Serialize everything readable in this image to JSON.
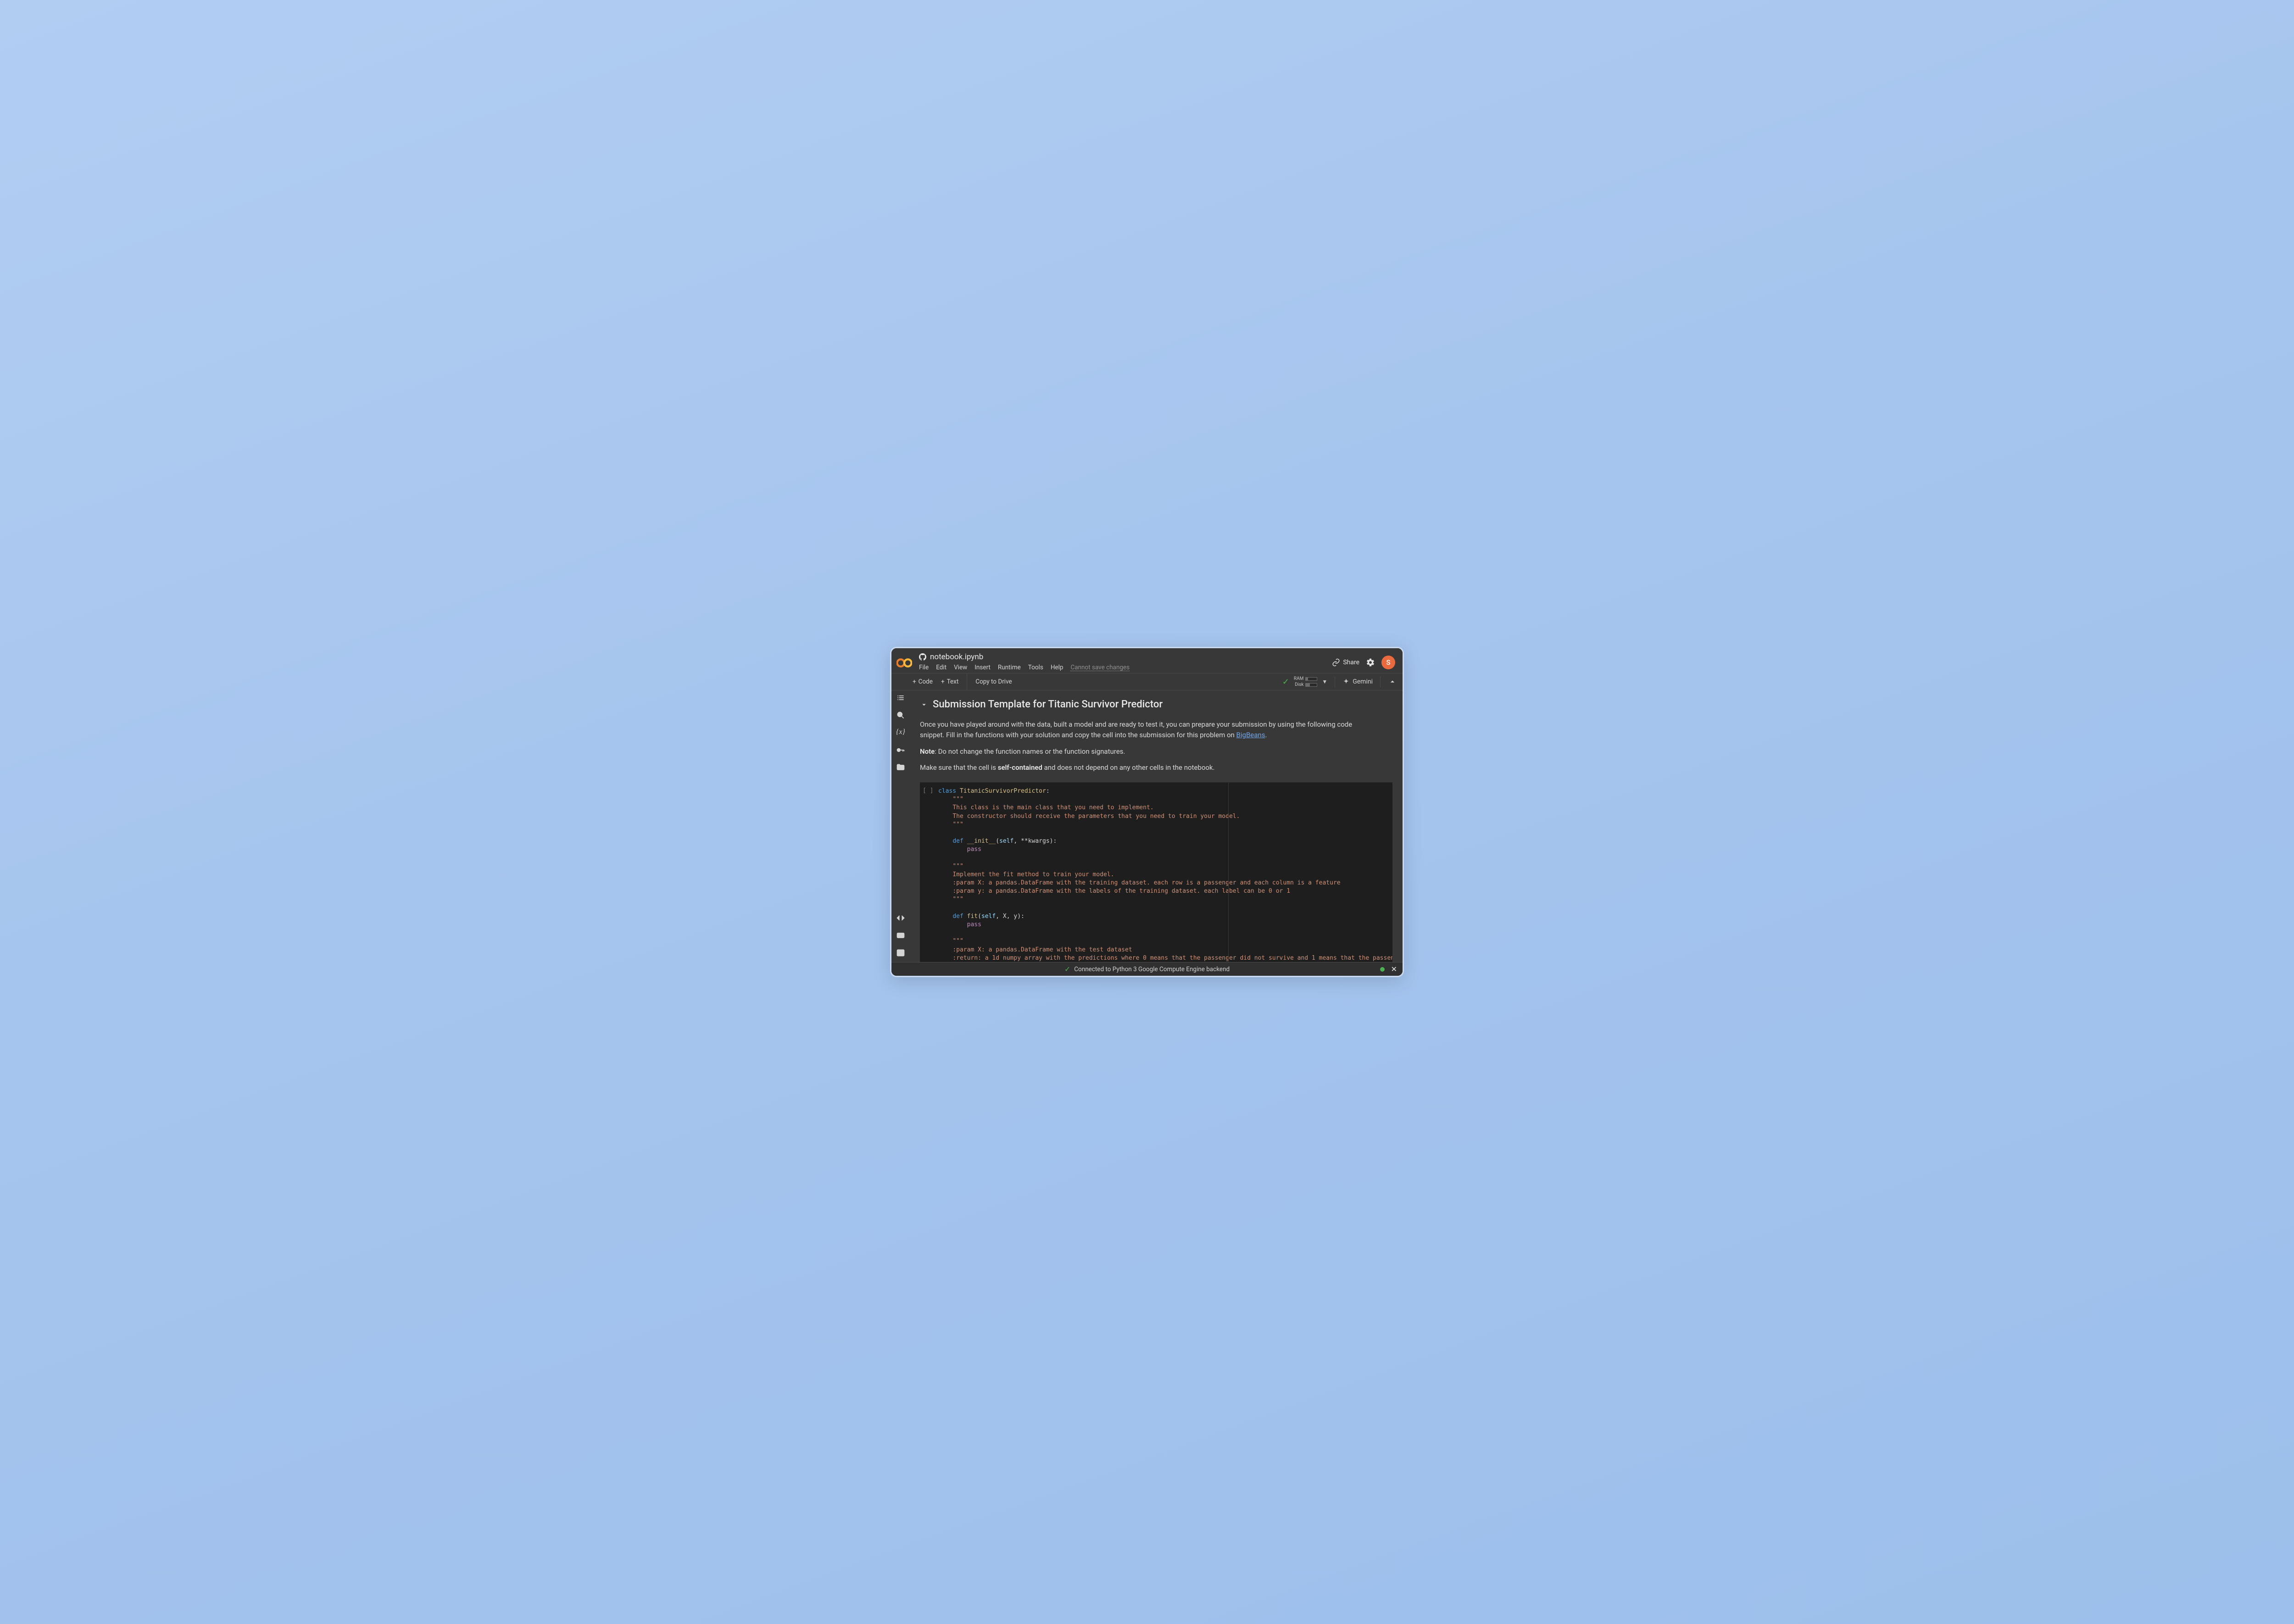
{
  "header": {
    "filename": "notebook.ipynb",
    "menus": [
      "File",
      "Edit",
      "View",
      "Insert",
      "Runtime",
      "Tools",
      "Help"
    ],
    "disabled_note": "Cannot save changes",
    "share_label": "Share",
    "avatar_letter": "S"
  },
  "toolbar": {
    "add_code": "Code",
    "add_text": "Text",
    "copy_to_drive": "Copy to Drive",
    "ram_label": "RAM",
    "disk_label": "Disk",
    "gemini_label": "Gemini"
  },
  "section": {
    "title": "Submission Template for Titanic Survivor Predictor"
  },
  "md": {
    "p1a": "Once you have played around with the data, built a model and are ready to test it, you can prepare your submission by using the following code snippet. Fill in the functions with your solution and copy the cell into the submission for this problem on ",
    "link1": "BigBeans",
    "p1b": ".",
    "p2a": "Note",
    "p2b": ": Do not change the function names or the function signatures.",
    "p3a": "Make sure that the cell is ",
    "p3b": "self-contained",
    "p3c": " and does not depend on any other cells in the notebook."
  },
  "cell": {
    "gutter": "[ ]",
    "code": {
      "l1_kw": "class",
      "l1_cls": " TitanicSurvivorPredictor",
      "l1_pn": ":",
      "doc_q": "\"\"\"",
      "l3": "This class is the main class that you need to implement.",
      "l4": "The constructor should receive the parameters that you need to train your model.",
      "def_kw": "def ",
      "init_name": "__init__",
      "init_args_open": "(",
      "init_self": "self",
      "init_rest": ", **kwargs):",
      "pass": "pass",
      "l8": "Implement the fit method to train your model.",
      "l9": ":param X: a pandas.DataFrame with the training dataset. each row is a passenger and each column is a feature",
      "l10": ":param y: a pandas.DataFrame with the labels of the training dataset. each label can be 0 or 1",
      "fit_name": "fit",
      "fit_args_open": "(",
      "fit_self": "self",
      "fit_rest": ", X, y):",
      "l13": ":param X: a pandas.DataFrame with the test dataset",
      "l14": ":return: a 1d numpy array with the predictions where 0 means that the passenger did not survive and 1 means that the passen"
    }
  },
  "status": {
    "text": "Connected to Python 3 Google Compute Engine backend"
  }
}
